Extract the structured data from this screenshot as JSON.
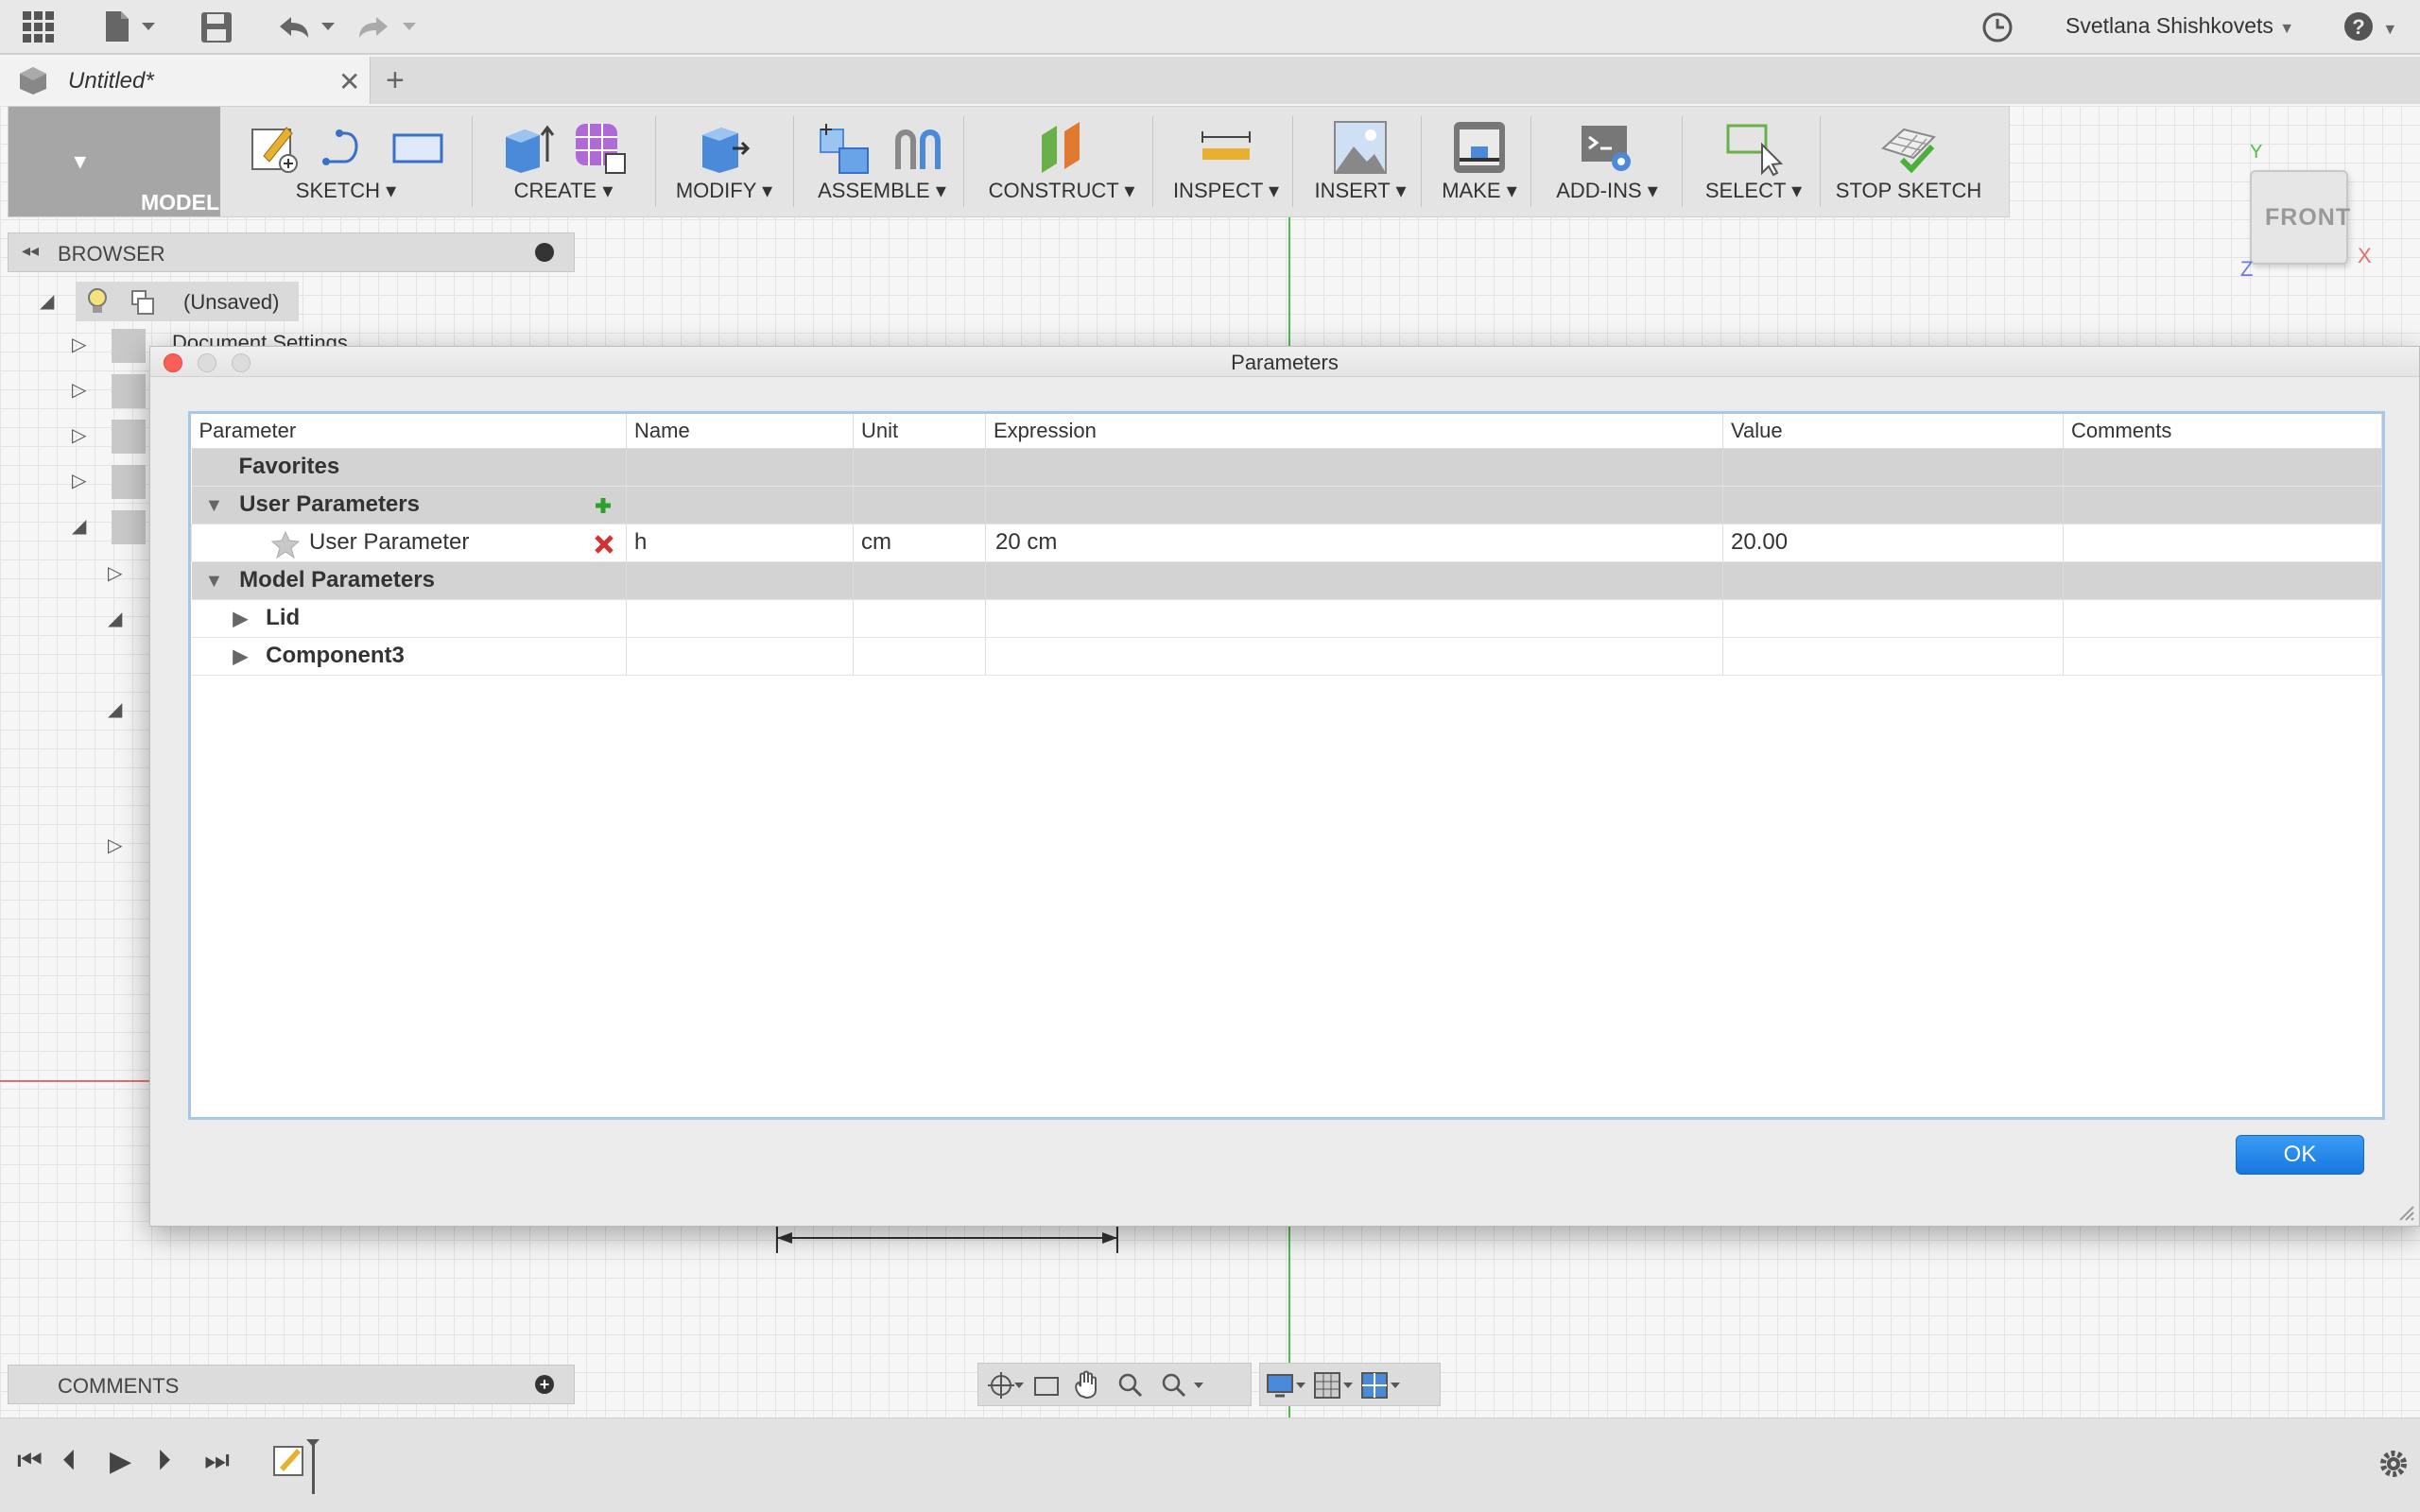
{
  "app": {
    "user_name": "Svetlana Shishkovets",
    "document_title": "Untitled*"
  },
  "toolbar": {
    "model_label": "MODEL",
    "groups": [
      {
        "label": "SKETCH"
      },
      {
        "label": "CREATE"
      },
      {
        "label": "MODIFY"
      },
      {
        "label": "ASSEMBLE"
      },
      {
        "label": "CONSTRUCT"
      },
      {
        "label": "INSPECT"
      },
      {
        "label": "INSERT"
      },
      {
        "label": "MAKE"
      },
      {
        "label": "ADD-INS"
      },
      {
        "label": "SELECT"
      },
      {
        "label": "STOP SKETCH"
      }
    ]
  },
  "viewcube": {
    "face": "FRONT",
    "axis_y": "Y",
    "axis_x": "X",
    "axis_z": "Z"
  },
  "browser": {
    "title": "BROWSER",
    "root": "(Unsaved)",
    "partial_item": "Document Settings"
  },
  "comments": {
    "title": "COMMENTS"
  },
  "dialog": {
    "title": "Parameters",
    "columns": [
      "Parameter",
      "Name",
      "Unit",
      "Expression",
      "Value",
      "Comments"
    ],
    "favorites_label": "Favorites",
    "user_params_label": "User Parameters",
    "user_params": [
      {
        "parameter": "User Parameter",
        "name": "h",
        "unit": "cm",
        "expression": "20 cm",
        "value": "20.00",
        "comments": ""
      }
    ],
    "model_params_label": "Model Parameters",
    "model_components": [
      "Lid",
      "Component3"
    ],
    "ok_label": "OK"
  },
  "colors": {
    "accent": "#1677e0",
    "axis_green": "#4cbf4c",
    "axis_red": "#e07070",
    "add_icon": "#2ea02e",
    "delete_icon": "#d63030"
  }
}
